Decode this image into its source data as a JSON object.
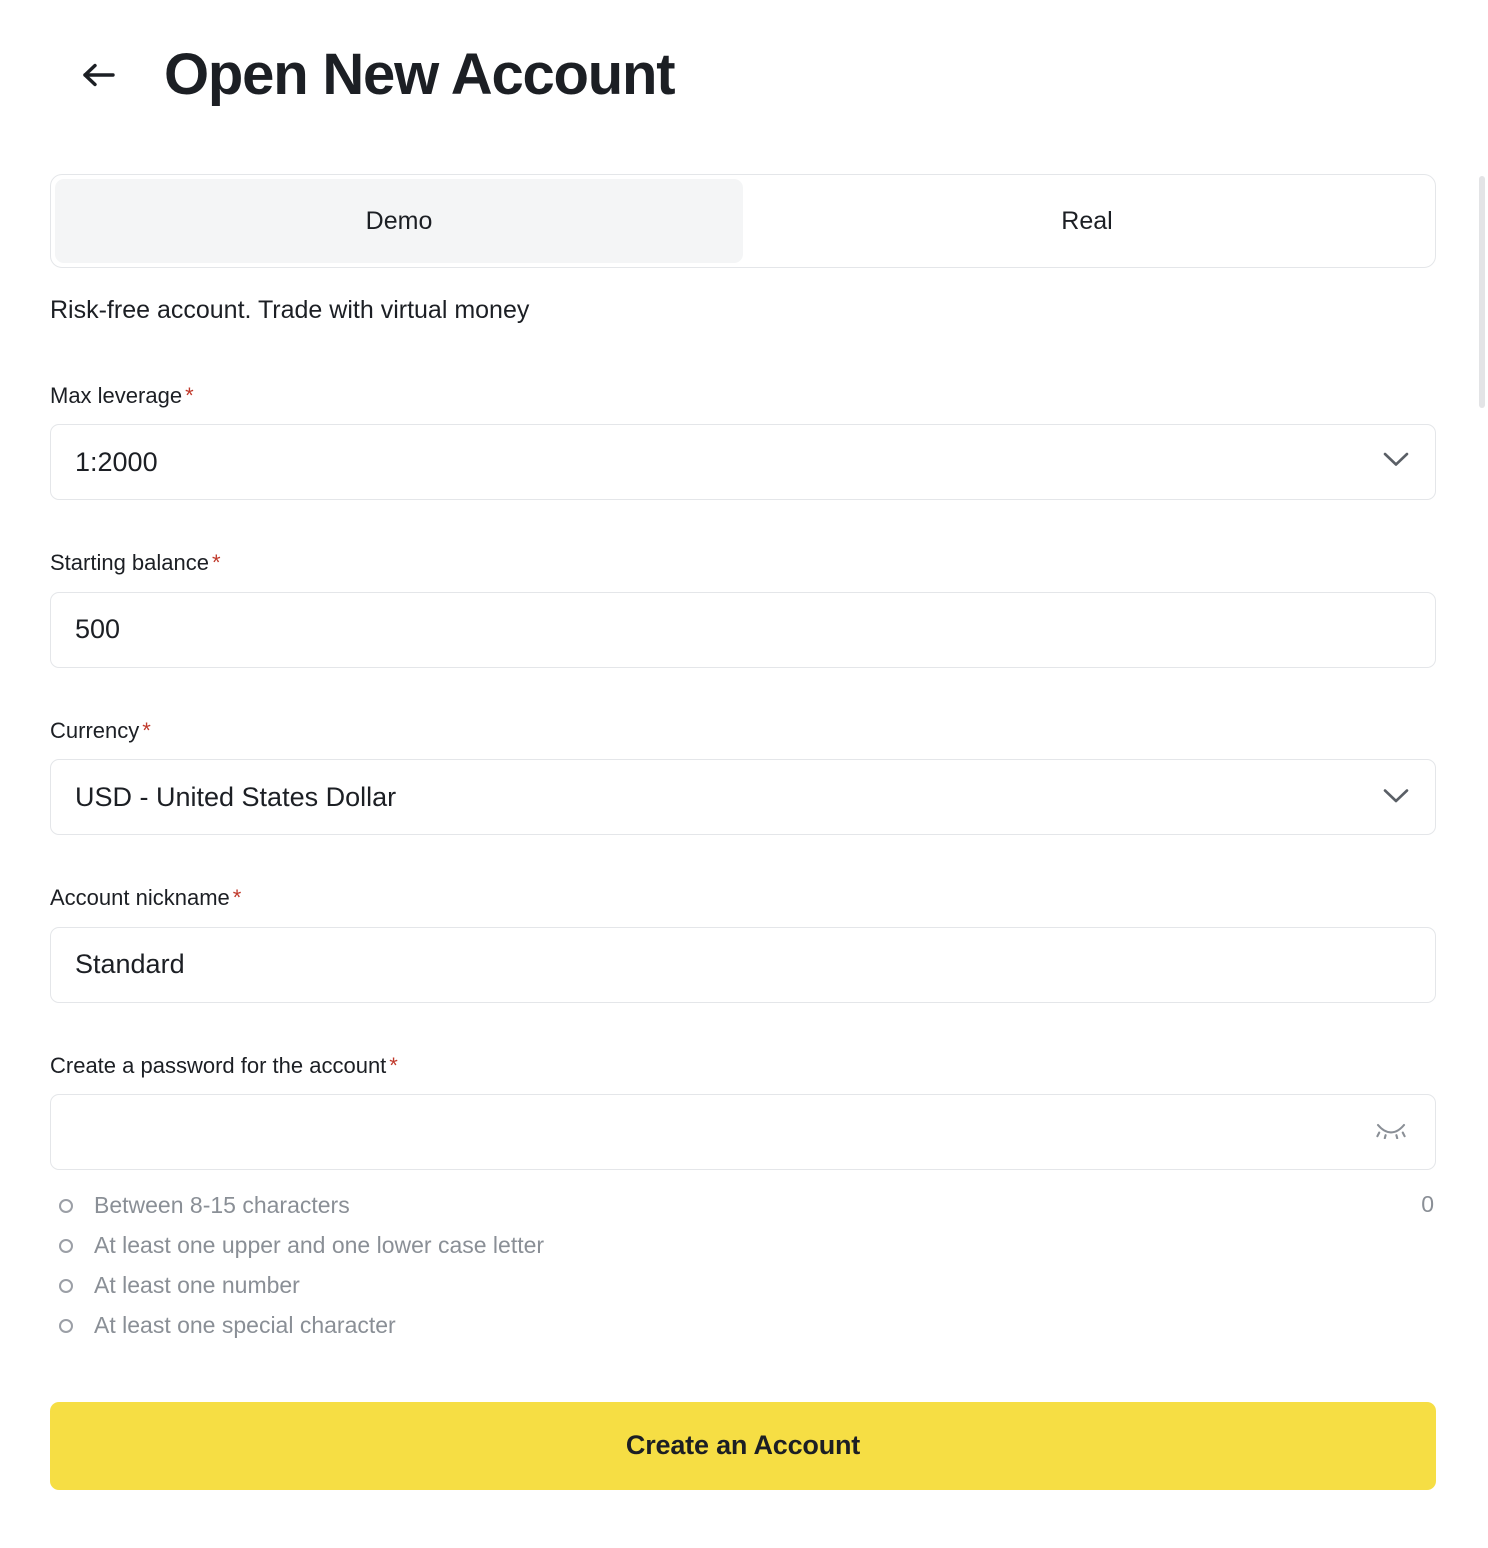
{
  "header": {
    "back_icon": "arrow-left-icon",
    "title": "Open New Account"
  },
  "account_type_tabs": {
    "items": [
      {
        "label": "Demo",
        "selected": true
      },
      {
        "label": "Real",
        "selected": false
      }
    ],
    "selected_label": "Demo"
  },
  "subtitle": "Risk-free account. Trade with virtual money",
  "required_marker": "*",
  "form": {
    "leverage": {
      "label": "Max leverage",
      "value": "1:2000",
      "required": true,
      "icon": "chevron-down-icon"
    },
    "starting_balance": {
      "label": "Starting balance",
      "value": "500",
      "required": true
    },
    "currency": {
      "label": "Currency",
      "value": "USD - United States Dollar",
      "required": true,
      "icon": "chevron-down-icon"
    },
    "nickname": {
      "label": "Account nickname",
      "value": "Standard",
      "required": true
    },
    "password": {
      "label": "Create a password for the account",
      "value": "",
      "placeholder": "",
      "required": true,
      "icon": "eye-off-icon",
      "char_count": "0",
      "rules": [
        "Between 8-15 characters",
        "At least one upper and one lower case letter",
        "At least one number",
        "At least one special character"
      ]
    }
  },
  "submit": {
    "label": "Create an Account",
    "color": "#f6de44"
  },
  "colors": {
    "text": "#1c1f24",
    "muted": "#8a8f96",
    "border": "#e4e6e9",
    "tab_selected_bg": "#f4f5f6",
    "required_star": "#c0392b",
    "accent": "#f6de44"
  }
}
